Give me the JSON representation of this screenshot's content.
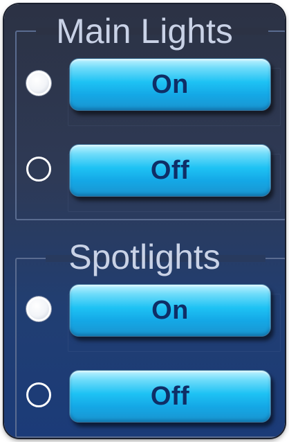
{
  "main_lights": {
    "title": "Main Lights",
    "on_label": "On",
    "off_label": "Off",
    "selected": "On"
  },
  "spotlights": {
    "title": "Spotlights",
    "on_label": "On",
    "off_label": "Off",
    "selected": "On"
  }
}
